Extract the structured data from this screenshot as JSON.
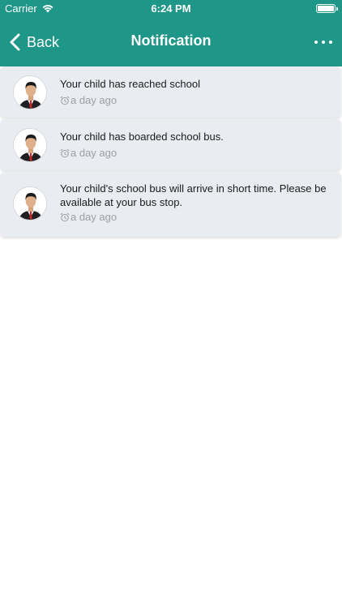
{
  "status_bar": {
    "carrier": "Carrier",
    "time": "6:24 PM",
    "wifi_icon": "wifi-icon",
    "battery_icon": "battery-icon"
  },
  "nav": {
    "back_label": "Back",
    "title": "Notification",
    "more_icon": "more-horizontal-icon"
  },
  "notifications": [
    {
      "message": "Your child has reached school",
      "time": "a day ago",
      "avatar_icon": "person-avatar-icon"
    },
    {
      "message": "Your child has boarded school bus.",
      "time": "a day ago",
      "avatar_icon": "person-avatar-icon"
    },
    {
      "message": "Your child's school bus will arrive in short time. Please be available at your bus stop.",
      "time": "a day ago",
      "avatar_icon": "person-avatar-icon"
    }
  ],
  "colors": {
    "header": "#1e9688",
    "card_background": "#e9ecf0",
    "timestamp": "#9aa0a6"
  }
}
